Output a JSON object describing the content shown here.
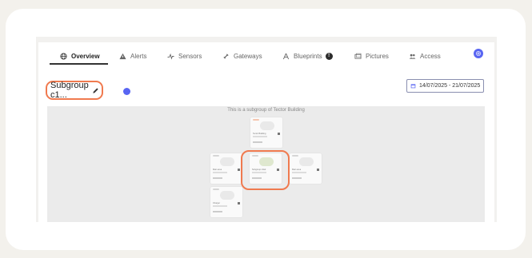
{
  "tabs": [
    {
      "label": "Overview",
      "icon": "globe-icon",
      "active": true
    },
    {
      "label": "Alerts",
      "icon": "warning-icon"
    },
    {
      "label": "Sensors",
      "icon": "pulse-icon"
    },
    {
      "label": "Gateways",
      "icon": "link-icon"
    },
    {
      "label": "Blueprints",
      "icon": "blueprint-icon",
      "badge": "!"
    },
    {
      "label": "Pictures",
      "icon": "pictures-icon"
    },
    {
      "label": "Access",
      "icon": "users-icon"
    }
  ],
  "header": {
    "title": "Subgroup c1...",
    "date_range": "14/07/2025 - 21/07/2025"
  },
  "canvas": {
    "caption": "This is a subgroup of Tector Building",
    "nodes": [
      {
        "name": "Tector Building"
      },
      {
        "name": "Main area"
      },
      {
        "name": "Subgroup c1&2"
      },
      {
        "name": "Main area"
      },
      {
        "name": "Charger"
      }
    ]
  },
  "colors": {
    "accent": "#5865f2",
    "highlight": "#f07a4f"
  }
}
